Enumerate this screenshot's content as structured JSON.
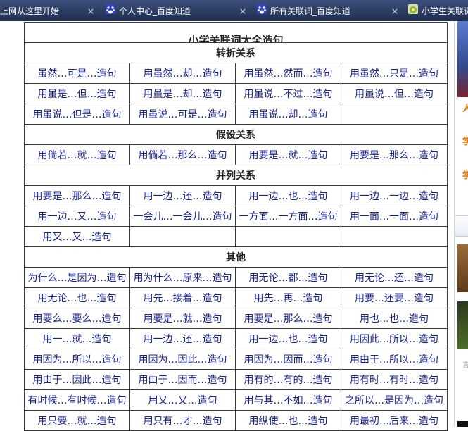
{
  "tabs": [
    {
      "label": "上网从这里开始",
      "close": "×",
      "icon": "ie-icon"
    },
    {
      "label": "个人中心_百度知道",
      "close": "×",
      "icon": "baidu-paw-icon"
    },
    {
      "label": "所有关联词_百度知道",
      "close": "×",
      "icon": "baidu-paw-icon"
    },
    {
      "label": "小学生关联词",
      "close": "",
      "icon": "page-favicon"
    }
  ],
  "table": {
    "title": "小学关联词大全造句",
    "sections": [
      {
        "heading": "转折关系",
        "rows": [
          [
            "虽然…可是…造句",
            "用虽然…却…造句",
            "用虽然…然而…造句",
            "用虽然…只是…造句"
          ],
          [
            "用虽是…但…造句",
            "用虽是…却…造句",
            "用虽说…不过…造句",
            "用虽说…但…造句"
          ],
          [
            "用虽说…但是…造句",
            "用虽说…可是…造句",
            "用虽说…却…造句",
            ""
          ]
        ]
      },
      {
        "heading": "假设关系",
        "rows": [
          [
            "用倘若…就…造句",
            "用倘若…那么…造句",
            "用要是…就…造句",
            "用要是…那么…造句"
          ]
        ]
      },
      {
        "heading": "并列关系",
        "rows": [
          [
            "用要是…那么…造句",
            "用一边…还…造句",
            "用一边…也…造句",
            "用一边…一边…造句"
          ],
          [
            "用一边…又…造句",
            "一会儿…一会儿…造句",
            "一方面…一方面…造句",
            "用一面…一面…造句"
          ],
          [
            "用又…又…造句",
            "",
            "",
            ""
          ]
        ]
      },
      {
        "heading": "其他",
        "rows": [
          [
            "为什么…是因为…造句",
            "用为什么…原来…造句",
            "用无论…都…造句",
            "用无论…还…造句"
          ],
          [
            "用无论…也…造句",
            "用先…接着…造句",
            "用先…再…造句",
            "用要…还要…造句"
          ],
          [
            "用要么…要么…造句",
            "用要是…就…造句",
            "用要是…那么…造句",
            "用也…也…造句"
          ],
          [
            "用一…就…造句",
            "用一边…还…造句",
            "用一边…也…造句",
            "用因此…所以…造句"
          ],
          [
            "用因为…所以…造句",
            "用因为…因此…造句",
            "用因为…因而…造句",
            "用由于…所以…造句"
          ],
          [
            "用由于…因此…造句",
            "用由于…因而…造句",
            "用有的…有的…造句",
            "用有时…有时…造句"
          ],
          [
            "有时候…有时候…造句",
            "用又…又…造句",
            "用与其…不如…造句",
            "之所以…是因为…造句"
          ],
          [
            "用只要…就…造句",
            "用只有…才…造句",
            "用纵使…也…造句",
            "用最初…后来…造句"
          ]
        ]
      }
    ]
  },
  "sidebar": {
    "fragments": [
      "人",
      "学",
      "学",
      "言"
    ],
    "colors": {
      "accent": "#e86a00",
      "link": "#19238c"
    }
  }
}
